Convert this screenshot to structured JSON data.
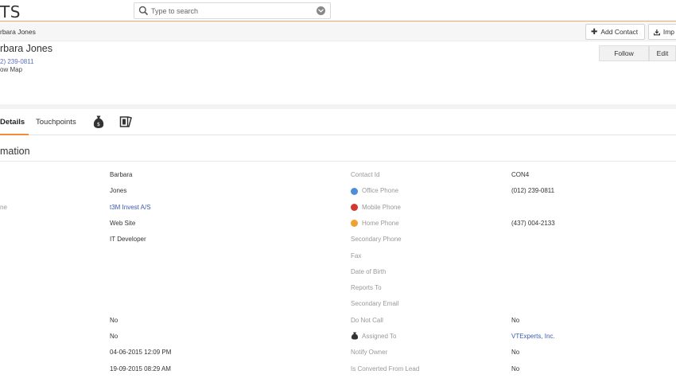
{
  "header": {
    "logo": "TS",
    "search_placeholder": "Type to search"
  },
  "crumbs": {
    "current": "rbara Jones"
  },
  "actions": {
    "add_contact": "Add Contact",
    "import": "Imp"
  },
  "record": {
    "name": "rbara Jones",
    "phone": "2) 239-0811",
    "show_map": "ow Map",
    "follow": "Follow",
    "edit": "Edit"
  },
  "tabs": {
    "details": "Details",
    "touchpoints": "Touchpoints"
  },
  "section": {
    "title": "mation"
  },
  "left_fields": {
    "r3_label": "ne",
    "first_name": "Barbara",
    "last_name": "Jones",
    "org": "t3M Invest A/S",
    "lead_source": "Web Site",
    "title": "IT Developer",
    "email_opt_out": "No",
    "do_not_call_left": "No",
    "created": "04-06-2015 12:09 PM",
    "modified": "19-09-2015 08:29 AM"
  },
  "right_fields": {
    "contact_id_label": "Contact Id",
    "contact_id": "CON4",
    "office_phone_label": "Office Phone",
    "office_phone": "(012) 239-0811",
    "mobile_phone_label": "Mobile Phone",
    "home_phone_label": "Home Phone",
    "home_phone": "(437) 004-2133",
    "secondary_phone_label": "Secondary Phone",
    "fax_label": "Fax",
    "dob_label": "Date of Birth",
    "reports_to_label": "Reports To",
    "secondary_email_label": "Secondary Email",
    "do_not_call_label": "Do Not Call",
    "do_not_call": "No",
    "assigned_to_label": "Assigned To",
    "assigned_to": "VTExperts, Inc.",
    "notify_owner_label": "Notify Owner",
    "notify_owner": "No",
    "converted_label": "Is Converted From Lead",
    "converted": "No"
  },
  "colors": {
    "accent": "#f38b3d",
    "link": "#3b5bb5",
    "office_icon": "#4a8fd8",
    "mobile_icon": "#d23a2f",
    "home_icon": "#f0a030"
  }
}
